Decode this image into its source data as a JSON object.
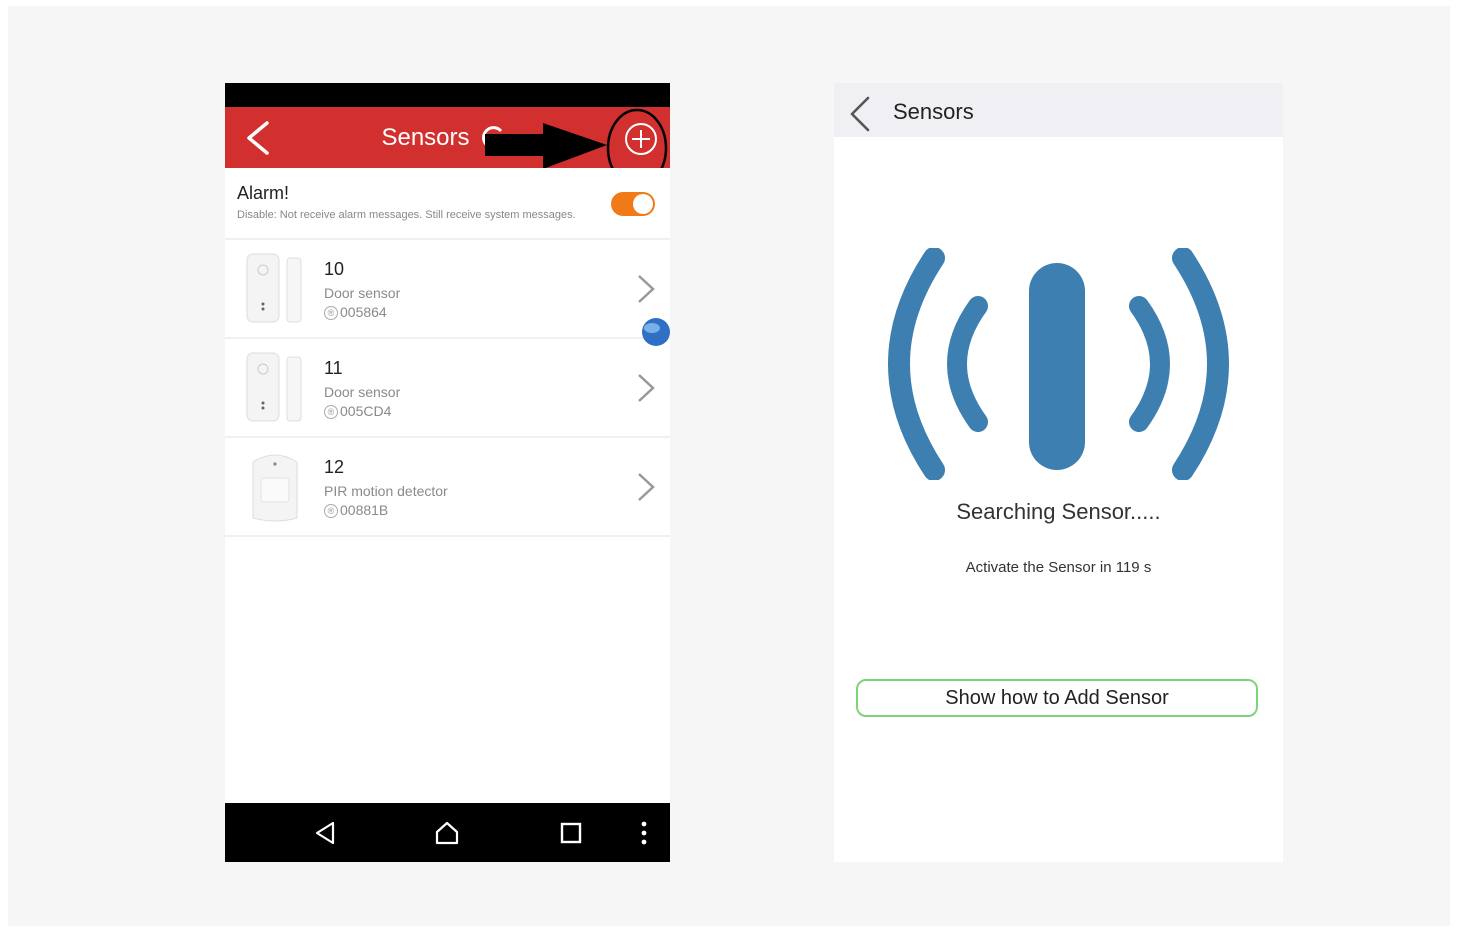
{
  "left_screen": {
    "header": {
      "title": "Sensors"
    },
    "alarm": {
      "title": "Alarm!",
      "description": "Disable: Not receive alarm messages. Still receive system messages.",
      "toggle_on": true,
      "toggle_color": "#f07a18"
    },
    "sensors": [
      {
        "number": "10",
        "type": "Door sensor",
        "id": "005864",
        "icon": "door-sensor-icon"
      },
      {
        "number": "11",
        "type": "Door sensor",
        "id": "005CD4",
        "icon": "door-sensor-icon"
      },
      {
        "number": "12",
        "type": "PIR motion detector",
        "id": "00881B",
        "icon": "pir-sensor-icon"
      }
    ],
    "nav_buttons": [
      "back-icon",
      "home-icon",
      "recents-icon",
      "more-icon"
    ],
    "colors": {
      "header": "#d22f2f",
      "status_bar": "#000000"
    }
  },
  "right_screen": {
    "header": {
      "title": "Sensors"
    },
    "searching_text": "Searching Sensor.....",
    "countdown_text": "Activate the Sensor in 119 s",
    "show_how_button": "Show how to Add Sensor",
    "colors": {
      "signal": "#3d7fb0",
      "button_border": "#7fd47a",
      "header_bg": "#efeff4"
    }
  }
}
